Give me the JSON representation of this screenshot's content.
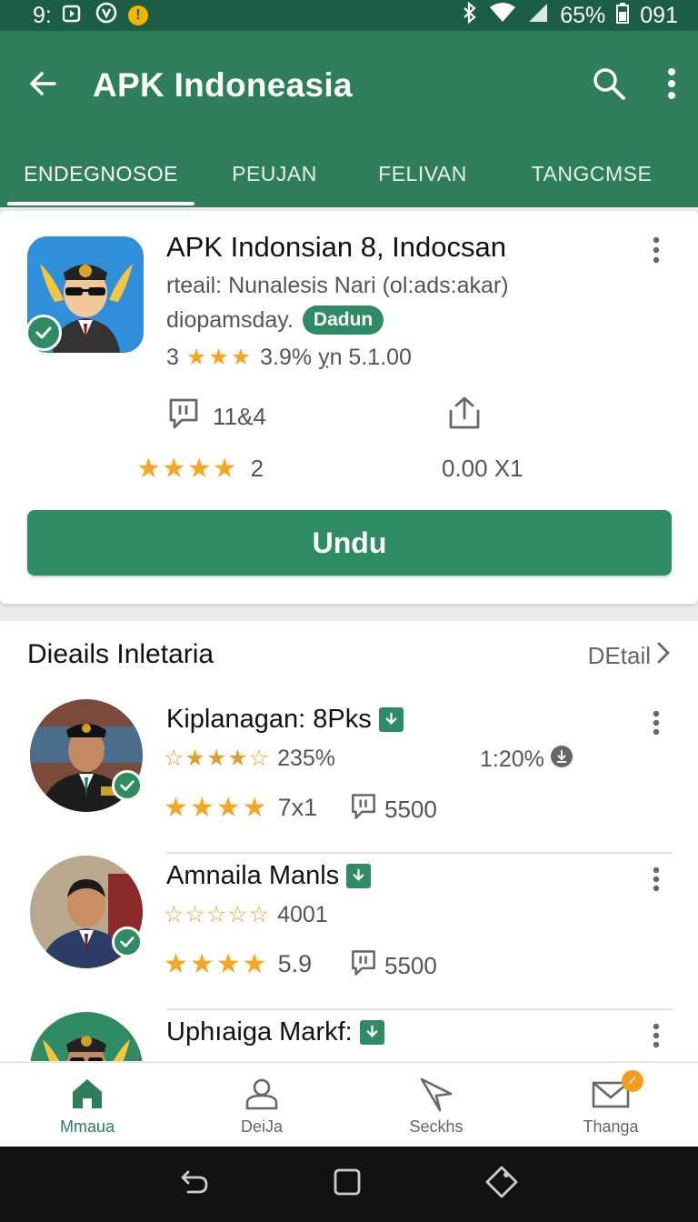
{
  "status_bar": {
    "time": "9:",
    "battery": "65%",
    "extra": "091",
    "icons": [
      "video-icon",
      "shield-icon",
      "warning-icon",
      "bluetooth-icon",
      "wifi-icon",
      "signal-icon",
      "battery-icon"
    ]
  },
  "app_bar": {
    "title": "APK Indoneasia",
    "icons": [
      "back-arrow-icon",
      "search-icon",
      "more-vert-icon"
    ]
  },
  "tabs": [
    {
      "label": "ENDEGNOSOE",
      "active": true
    },
    {
      "label": "PEUJAN",
      "active": false
    },
    {
      "label": "FELIVAN",
      "active": false
    },
    {
      "label": "TANGCMSE",
      "active": false
    }
  ],
  "app_card": {
    "title": "APK Indonsian 8, Indocsan",
    "line1": "rteail: Nunalesis Nari (ol:ads:akar)",
    "line2": "diopamsday.",
    "badge": "Dadun",
    "rating_prefix": "3",
    "rating_suffix": "3.9% ỵn 5.1.00",
    "comments": "11&4",
    "stars_count": "2",
    "share_value": "0.00 X1",
    "button_label": "Undu",
    "accent": "#2e8b63"
  },
  "section": {
    "title": "Dieails Inletaria",
    "link": "DEtail"
  },
  "items": [
    {
      "name": "Kiplanagan: 8Pks",
      "rating": "235%",
      "side": "1:20%",
      "stars2": "7x1",
      "comments": "5500"
    },
    {
      "name": "Amnaila Manls",
      "rating": "4001",
      "side": "",
      "stars2": "5.9",
      "comments": "5500"
    },
    {
      "name": "Uphıaiga Markf:",
      "rating": "",
      "side": "",
      "stars2": "",
      "comments": ""
    }
  ],
  "bottom_nav": [
    {
      "label": "Mmaua",
      "icon": "home-icon",
      "active": true
    },
    {
      "label": "DeiJa",
      "icon": "person-icon",
      "active": false
    },
    {
      "label": "Seckhs",
      "icon": "send-icon",
      "active": false
    },
    {
      "label": "Thanga",
      "icon": "mail-icon",
      "active": false,
      "badge": "✓"
    }
  ],
  "colors": {
    "primary_dark": "#1b5e45",
    "primary": "#2e7d5b",
    "star": "#f5a623"
  }
}
